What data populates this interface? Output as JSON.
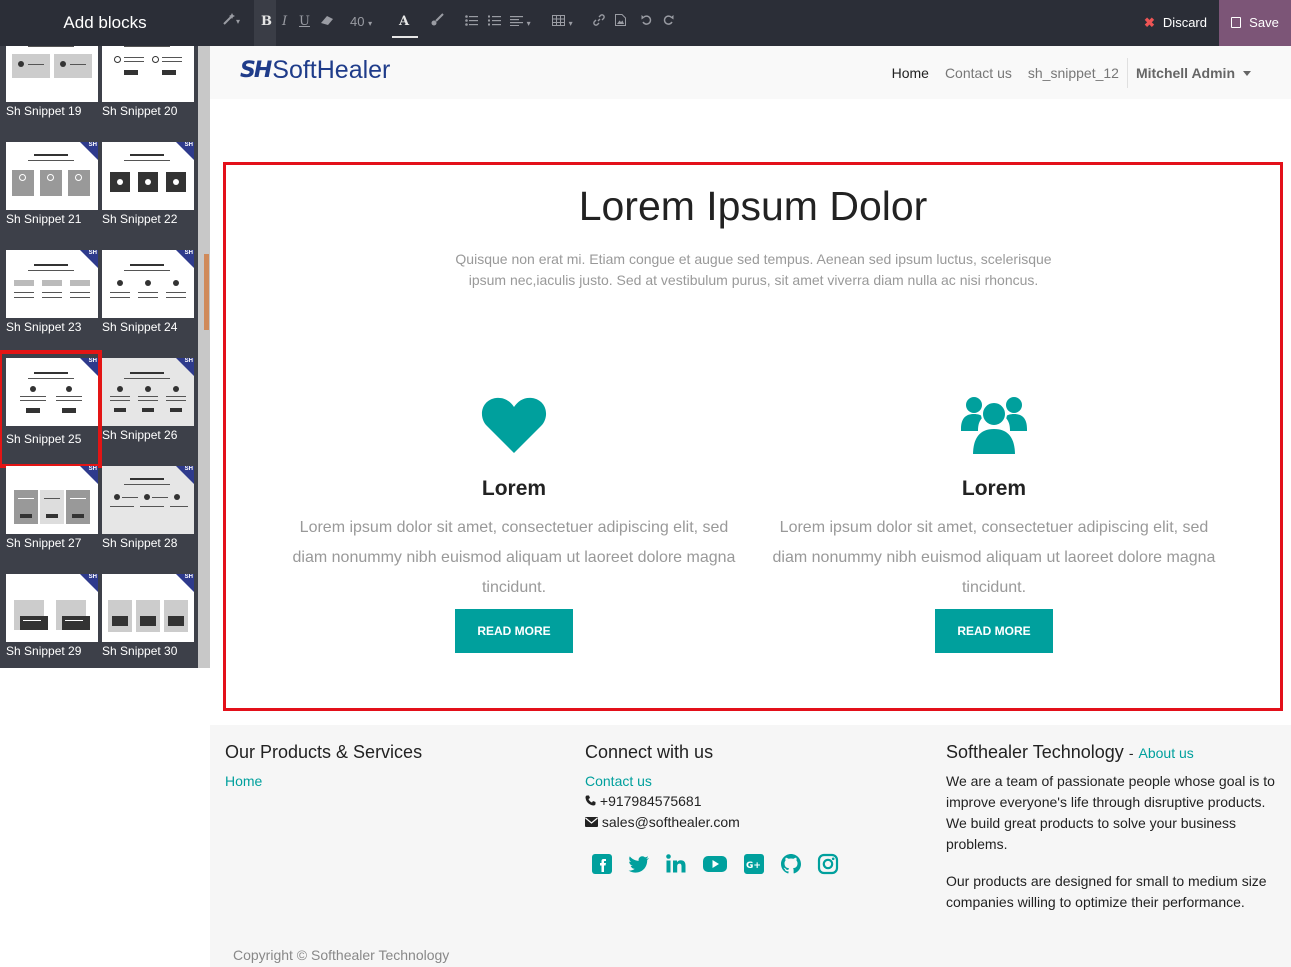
{
  "sidebar": {
    "title": "Add blocks",
    "snippets": [
      {
        "label": "Sh Snippet 19",
        "selected": false
      },
      {
        "label": "Sh Snippet 20",
        "selected": false
      },
      {
        "label": "Sh Snippet 21",
        "selected": false
      },
      {
        "label": "Sh Snippet 22",
        "selected": false
      },
      {
        "label": "Sh Snippet 23",
        "selected": false
      },
      {
        "label": "Sh Snippet 24",
        "selected": false
      },
      {
        "label": "Sh Snippet 25",
        "selected": true
      },
      {
        "label": "Sh Snippet 26",
        "selected": false
      },
      {
        "label": "Sh Snippet 27",
        "selected": false
      },
      {
        "label": "Sh Snippet 28",
        "selected": false
      },
      {
        "label": "Sh Snippet 29",
        "selected": false
      },
      {
        "label": "Sh Snippet 30",
        "selected": false
      }
    ],
    "badge_text": "SH"
  },
  "toolbar": {
    "font_size": "40",
    "discard_label": "Discard",
    "save_label": "Save"
  },
  "site": {
    "logo_mark": "SH",
    "logo_name": "SoftHealer",
    "nav": [
      {
        "label": "Home",
        "current": true
      },
      {
        "label": "Contact us",
        "current": false
      },
      {
        "label": "sh_snippet_12",
        "current": false
      }
    ],
    "user": "Mitchell Admin"
  },
  "hero": {
    "title": "Lorem Ipsum Dolor",
    "subtitle": "Quisque non erat mi. Etiam congue et augue sed tempus. Aenean sed ipsum luctus, scelerisque ipsum nec,iaculis justo. Sed at vestibulum purus, sit amet viverra diam nulla ac nisi rhoncus.",
    "features": [
      {
        "icon": "heart-icon",
        "heading": "Lorem",
        "text": "Lorem ipsum dolor sit amet, consectetuer adipiscing elit, sed diam nonummy nibh euismod aliquam ut laoreet dolore magna tincidunt.",
        "button": "READ MORE"
      },
      {
        "icon": "users-icon",
        "heading": "Lorem",
        "text": "Lorem ipsum dolor sit amet, consectetuer adipiscing elit, sed diam nonummy nibh euismod aliquam ut laoreet dolore magna tincidunt.",
        "button": "READ MORE"
      }
    ]
  },
  "footer": {
    "col1": {
      "title": "Our Products & Services",
      "link": "Home"
    },
    "col2": {
      "title": "Connect with us",
      "link": "Contact us",
      "phone": "+917984575681",
      "email": "sales@softhealer.com",
      "social": [
        "facebook-icon",
        "twitter-icon",
        "linkedin-icon",
        "youtube-icon",
        "google-plus-icon",
        "github-icon",
        "instagram-icon"
      ]
    },
    "col3": {
      "title": "Softhealer Technology",
      "title_sep": "-",
      "link": "About us",
      "para1": "We are a team of passionate people whose goal is to improve everyone's life through disruptive products. We build great products to solve your business problems.",
      "para2": "Our products are designed for small to medium size companies willing to optimize their performance."
    },
    "copyright": "Copyright © Softhealer Technology"
  },
  "colors": {
    "accent": "#00a09d",
    "highlight": "#e3101a",
    "toolbar_bg": "#2b2e37",
    "save_bg": "#7c5577",
    "brand": "#1f3c8a"
  }
}
